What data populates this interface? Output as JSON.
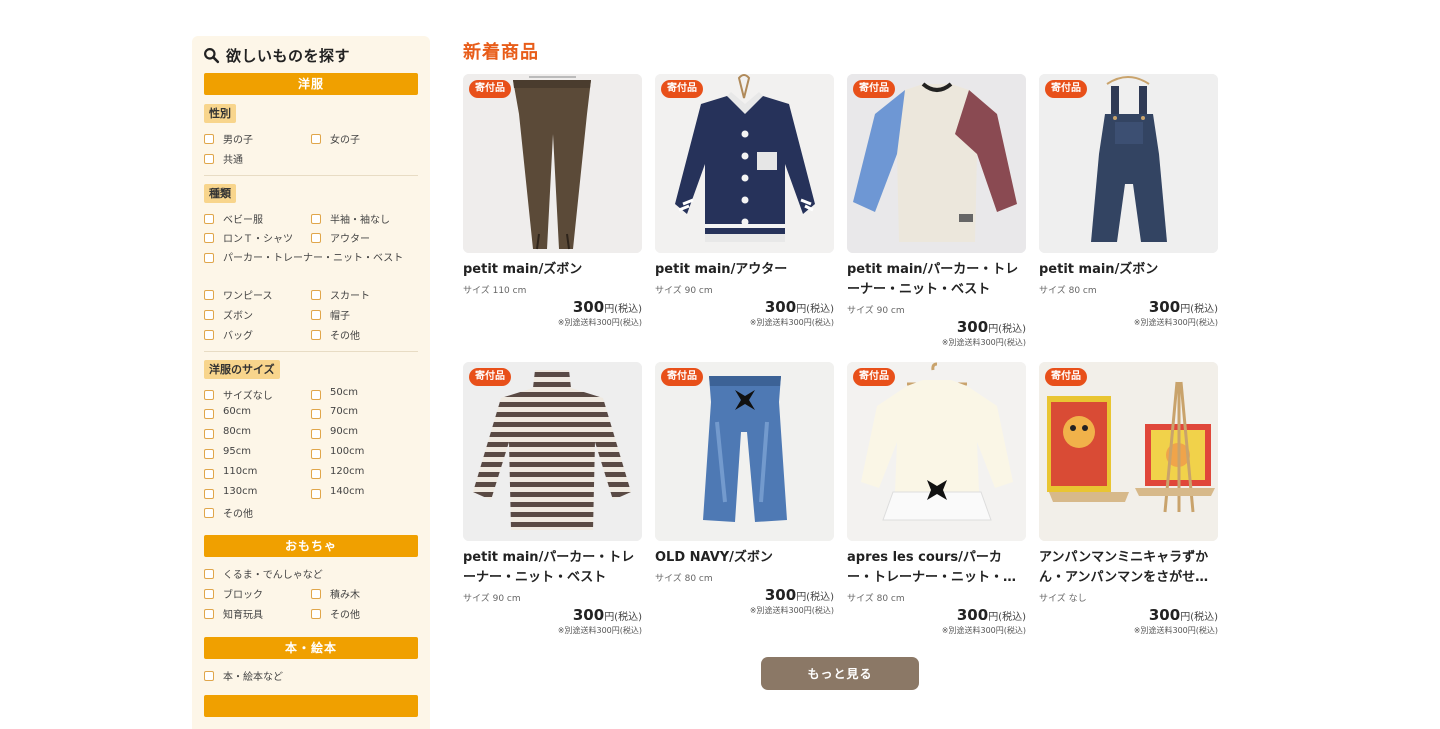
{
  "sidebar": {
    "title": "欲しいものを探す",
    "clothes_bar": "洋服",
    "gender_label": "性別",
    "gender_options": [
      "男の子",
      "女の子",
      "共通"
    ],
    "type_label": "種類",
    "type_options": [
      "ベビー服",
      "半袖・袖なし",
      "ロンＴ・シャツ",
      "アウター",
      "パーカー・トレーナー・ニット・ベスト",
      "ワンピース",
      "スカート",
      "ズボン",
      "帽子",
      "バッグ",
      "その他"
    ],
    "size_label": "洋服のサイズ",
    "size_options": [
      "サイズなし",
      "50cm",
      "60cm",
      "70cm",
      "80cm",
      "90cm",
      "95cm",
      "100cm",
      "110cm",
      "120cm",
      "130cm",
      "140cm",
      "その他"
    ],
    "toys_bar": "おもちゃ",
    "toy_options": [
      "くるま・でんしゃなど",
      "ブロック",
      "積み木",
      "知育玩具",
      "その他"
    ],
    "books_bar": "本・絵本",
    "book_options": [
      "本・絵本など"
    ]
  },
  "main": {
    "section_title": "新着商品",
    "more_button": "もっと見る",
    "products": [
      {
        "badge": "寄付品",
        "name": "petit main/ズボン",
        "size": "サイズ 110 cm",
        "price": "300",
        "price_unit": "円(税込)",
        "shipping": "※別途送料300円(税込)",
        "image": "brown-pants"
      },
      {
        "badge": "寄付品",
        "name": "petit main/アウター",
        "size": "サイズ 90 cm",
        "price": "300",
        "price_unit": "円(税込)",
        "shipping": "※別途送料300円(税込)",
        "image": "navy-jacket"
      },
      {
        "badge": "寄付品",
        "name": "petit main/パーカー・トレーナー・ニット・ベスト",
        "size": "サイズ 90 cm",
        "price": "300",
        "price_unit": "円(税込)",
        "shipping": "※別途送料300円(税込)",
        "image": "colorblock-sweater"
      },
      {
        "badge": "寄付品",
        "name": "petit main/ズボン",
        "size": "サイズ 80 cm",
        "price": "300",
        "price_unit": "円(税込)",
        "shipping": "※別途送料300円(税込)",
        "image": "denim-overalls"
      },
      {
        "badge": "寄付品",
        "name": "petit main/パーカー・トレーナー・ニット・ベスト",
        "size": "サイズ 90 cm",
        "price": "300",
        "price_unit": "円(税込)",
        "shipping": "※別途送料300円(税込)",
        "image": "striped-turtleneck"
      },
      {
        "badge": "寄付品",
        "name": "OLD NAVY/ズボン",
        "size": "サイズ 80 cm",
        "price": "300",
        "price_unit": "円(税込)",
        "shipping": "※別途送料300円(税込)",
        "image": "blue-jeans"
      },
      {
        "badge": "寄付品",
        "name": "apres les cours/パーカー・トレーナー・ニット・…",
        "size": "サイズ 80 cm",
        "price": "300",
        "price_unit": "円(税込)",
        "shipping": "※別途送料300円(税込)",
        "image": "white-top"
      },
      {
        "badge": "寄付品",
        "name": "アンパンマンミニキャラずかん・アンパンマンをさがせ…",
        "size": "サイズ なし",
        "price": "300",
        "price_unit": "円(税込)",
        "shipping": "※別途送料300円(税込)",
        "image": "picture-books"
      }
    ]
  },
  "colors": {
    "accent_orange": "#f0a000",
    "title_orange": "#e85d1a",
    "badge": "#e8501a",
    "sidebar_bg": "#fdf6e8",
    "button_brown": "#8b7866"
  }
}
